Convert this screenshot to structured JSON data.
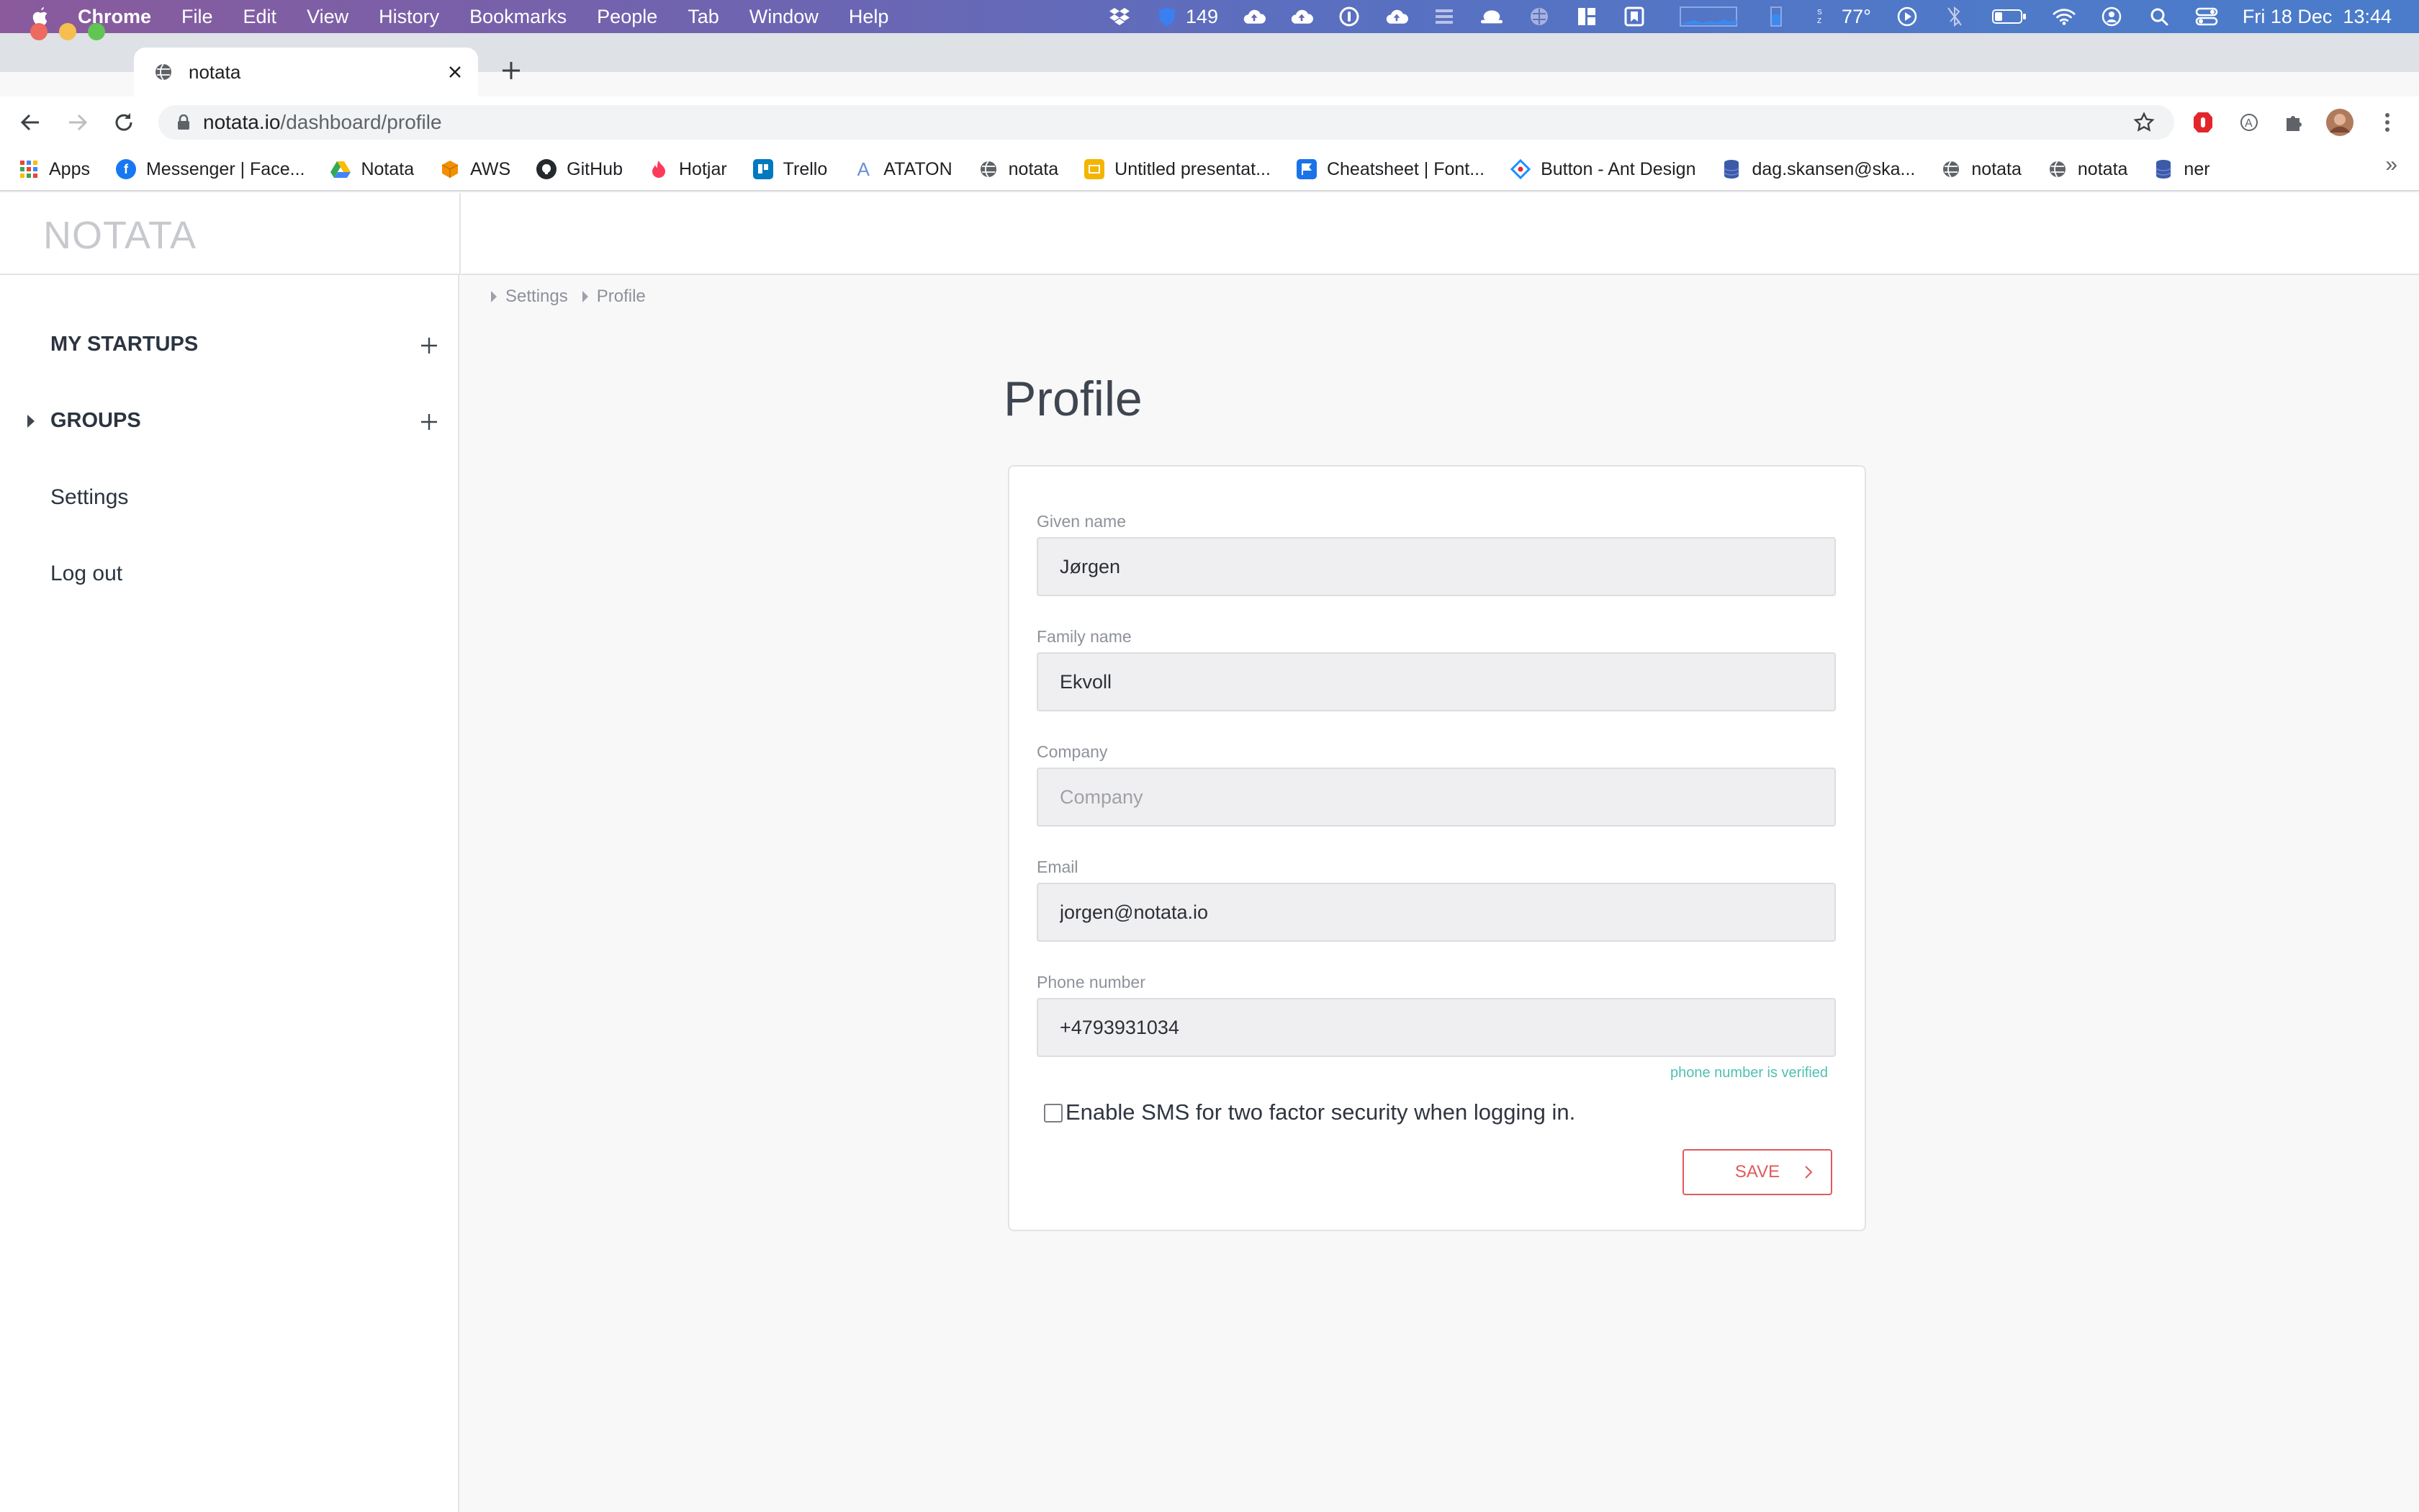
{
  "menubar": {
    "app_name": "Chrome",
    "items": [
      "File",
      "Edit",
      "View",
      "History",
      "Bookmarks",
      "People",
      "Tab",
      "Window",
      "Help"
    ],
    "status_count": "149",
    "temperature": "77°",
    "datetime": "Fri 18 Dec  13:44"
  },
  "browser": {
    "tab_title": "notata",
    "url_host": "notata.io",
    "url_path": "/dashboard/profile"
  },
  "bookmarks": {
    "items": [
      {
        "label": "Apps",
        "icon": "apps-grid-icon",
        "color": "#4285f4"
      },
      {
        "label": "Messenger | Face...",
        "icon": "facebook-icon",
        "color": "#1877f2"
      },
      {
        "label": "Notata",
        "icon": "google-drive-icon",
        "color": "#34a853"
      },
      {
        "label": "AWS",
        "icon": "aws-cube-icon",
        "color": "#f29100"
      },
      {
        "label": "GitHub",
        "icon": "github-icon",
        "color": "#24292e"
      },
      {
        "label": "Hotjar",
        "icon": "hotjar-flame-icon",
        "color": "#fd3a5c"
      },
      {
        "label": "Trello",
        "icon": "trello-icon",
        "color": "#0079bf"
      },
      {
        "label": "ATATON",
        "icon": "ataton-icon",
        "color": "#6a8fd8"
      },
      {
        "label": "notata",
        "icon": "globe-icon",
        "color": "#5f6368"
      },
      {
        "label": "Untitled presentat...",
        "icon": "slides-icon",
        "color": "#f4b400"
      },
      {
        "label": "Cheatsheet | Font...",
        "icon": "flag-icon",
        "color": "#1a73e8"
      },
      {
        "label": "Button - Ant Design",
        "icon": "ant-design-icon",
        "color": "#1890ff"
      },
      {
        "label": "dag.skansen@ska...",
        "icon": "database-icon",
        "color": "#3b5ba9"
      },
      {
        "label": "notata",
        "icon": "globe-icon",
        "color": "#5f6368"
      },
      {
        "label": "notata",
        "icon": "globe-icon",
        "color": "#5f6368"
      },
      {
        "label": "ner",
        "icon": "database-icon",
        "color": "#3b5ba9"
      }
    ],
    "more": "»"
  },
  "app": {
    "logo": "NOTATA",
    "sidebar": {
      "my_startups": "MY STARTUPS",
      "groups": "GROUPS",
      "settings": "Settings",
      "logout": "Log out"
    },
    "breadcrumb": [
      "Settings",
      "Profile"
    ],
    "page_title": "Profile",
    "form": {
      "given_name_label": "Given name",
      "given_name_value": "Jørgen",
      "family_name_label": "Family name",
      "family_name_value": "Ekvoll",
      "company_label": "Company",
      "company_placeholder": "Company",
      "email_label": "Email",
      "email_value": "jorgen@notata.io",
      "phone_label": "Phone number",
      "phone_value": "+4793931034",
      "phone_verified": "phone number is verified",
      "sms_label": "Enable SMS for two factor security when logging in.",
      "sms_checked": false,
      "save_label": "SAVE"
    }
  },
  "colors": {
    "accent": "#e05a5a",
    "verified": "#4fc1b0"
  }
}
